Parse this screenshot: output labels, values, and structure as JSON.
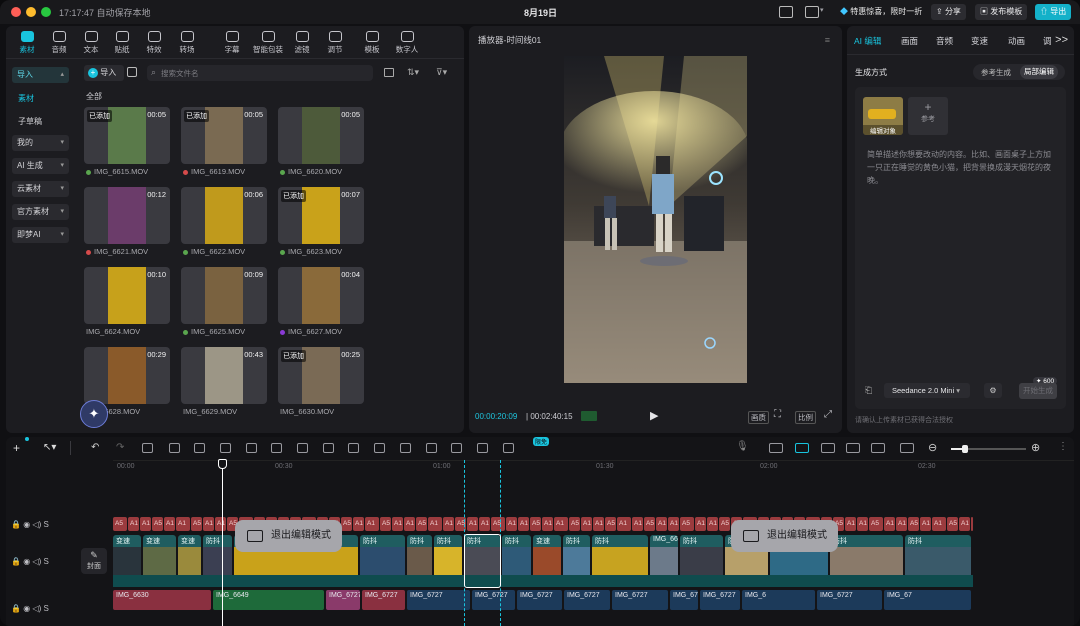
{
  "titlebar": {
    "status": "17:17:47 自动保存本地",
    "date": "8月19日",
    "promo": "特惠惊喜，限时一折",
    "share": "分享",
    "publish_template": "发布模板",
    "export": "导出"
  },
  "media_tabs": [
    {
      "label": "素材",
      "icon": "media-icon",
      "active": true
    },
    {
      "label": "音频",
      "icon": "audio-icon"
    },
    {
      "label": "文本",
      "icon": "text-icon"
    },
    {
      "label": "贴纸",
      "icon": "sticker-icon"
    },
    {
      "label": "特效",
      "icon": "effects-icon"
    },
    {
      "label": "转场",
      "icon": "transition-icon"
    },
    {
      "label": "字幕",
      "icon": "subtitle-icon"
    },
    {
      "label": "智能包装",
      "icon": "smart-pack-icon"
    },
    {
      "label": "滤镜",
      "icon": "filter-icon"
    },
    {
      "label": "调节",
      "icon": "adjust-icon"
    },
    {
      "label": "模板",
      "icon": "template-icon"
    },
    {
      "label": "数字人",
      "icon": "avatar-icon"
    }
  ],
  "sidebar": {
    "import_label": "导入",
    "material": "素材",
    "subtitle_draft": "子草稿",
    "items": [
      "我的",
      "AI 生成",
      "云素材",
      "官方素材",
      "即梦AI"
    ]
  },
  "media": {
    "import_button": "导入",
    "search_placeholder": "搜索文件名",
    "section_all": "全部",
    "added_badge": "已添加",
    "items": [
      {
        "name": "IMG_6615.MOV",
        "duration": "00:05",
        "added": true,
        "dot": "#5aa64e"
      },
      {
        "name": "IMG_6619.MOV",
        "duration": "00:05",
        "added": true,
        "dot": "#d64b4b"
      },
      {
        "name": "IMG_6620.MOV",
        "duration": "00:05",
        "added": false,
        "dot": "#5aa64e"
      },
      {
        "name": "IMG_6621.MOV",
        "duration": "00:12",
        "added": false,
        "dot": "#d64b4b"
      },
      {
        "name": "IMG_6622.MOV",
        "duration": "00:06",
        "added": false,
        "dot": "#5aa64e"
      },
      {
        "name": "IMG_6623.MOV",
        "duration": "00:07",
        "added": true,
        "dot": "#5aa64e"
      },
      {
        "name": "IMG_6624.MOV",
        "duration": "00:10",
        "added": false,
        "dot": ""
      },
      {
        "name": "IMG_6625.MOV",
        "duration": "00:09",
        "added": false,
        "dot": "#5aa64e"
      },
      {
        "name": "IMG_6627.MOV",
        "duration": "00:04",
        "added": false,
        "dot": "#8a3ad6"
      },
      {
        "name": "IMG_6628.MOV",
        "duration": "00:29",
        "added": false,
        "dot": ""
      },
      {
        "name": "IMG_6629.MOV",
        "duration": "00:43",
        "added": false,
        "dot": ""
      },
      {
        "name": "IMG_6630.MOV",
        "duration": "00:25",
        "added": true,
        "dot": ""
      }
    ]
  },
  "player": {
    "title": "播放器-时间线01",
    "current_time": "00:00:20:09",
    "total_time": "00:02:40:15",
    "quality": "画质",
    "ratio": "比例"
  },
  "right_panel": {
    "tabs": [
      "AI 编辑",
      "画面",
      "音频",
      "变速",
      "动画",
      "调"
    ],
    "gen_mode": "生成方式",
    "ref_gen": "参考生成",
    "local_edit": "局部编辑",
    "edit_target": "编辑对象",
    "reference": "参考",
    "prompt": "简单描述你想要改动的内容。比如、画面桌子上方加一只正在睡觉的黄色小猫，把背景换成漫天烟花的夜晚。",
    "model": "Seedance 2.0 Mini",
    "credits": "600",
    "start_gen": "开始生成",
    "note": "请确认上传素材已获得合法授权"
  },
  "timeline": {
    "ruler": [
      "00:00",
      "00:30",
      "01:00",
      "01:30",
      "02:00",
      "02:30"
    ],
    "new_badge": "限免",
    "cover": "封面",
    "exit_edit": "退出编辑模式",
    "audio_clip_prefix": "A1",
    "audio_clip_alt": "A5",
    "video_labels": [
      "变速",
      "变速",
      "变速",
      "防抖",
      "变速 0.5",
      "防抖",
      "防抖",
      "防抖",
      "防抖",
      "防抖",
      "变速",
      "防抖",
      "防抖",
      "IMG_66",
      "防抖",
      "防抖",
      "防抖",
      "防抖",
      "防抖"
    ],
    "bottom_clips": [
      "IMG_6630",
      "IMG_6649",
      "IMG_6727",
      "IMG_6727",
      "IMG_6727",
      "IMG_6727",
      "IMG_6727",
      "IMG_6727",
      "IMG_6727",
      "IMG_6727",
      "IMG_6727",
      "IMG_6",
      "IMG_6727",
      "IMG_67"
    ]
  }
}
